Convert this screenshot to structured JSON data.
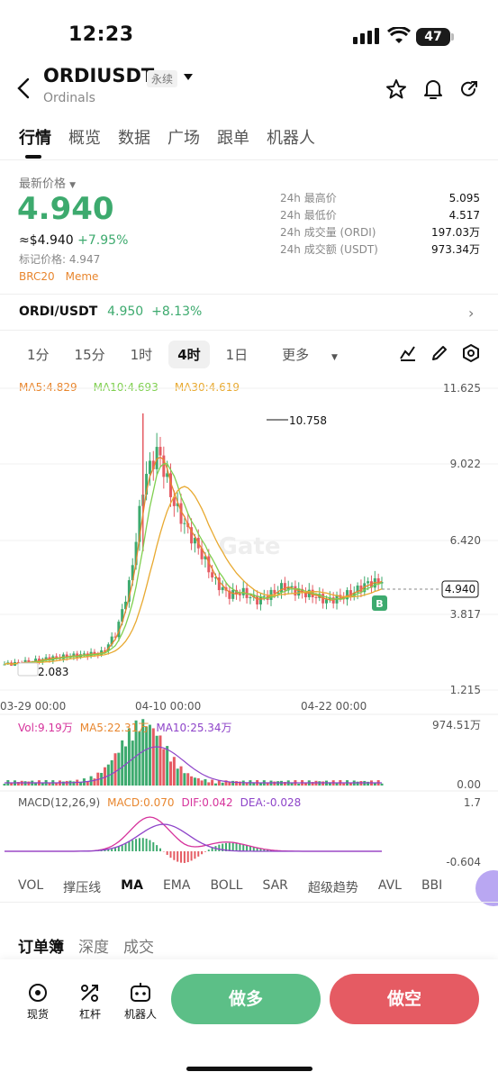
{
  "status": {
    "time": "12:23",
    "battery": "47"
  },
  "header": {
    "symbol": "ORDIUSDT",
    "type_tag": "永续",
    "subtitle": "Ordinals"
  },
  "tabs": [
    "行情",
    "概览",
    "数据",
    "广场",
    "跟单",
    "机器人"
  ],
  "ticker": {
    "price_label": "最新价格",
    "last_price": "4.940",
    "usd_price": "≈$4.940",
    "change_pct": "+7.95%",
    "mark_price": "标记价格: 4.947",
    "tags": [
      "BRC20",
      "Meme"
    ]
  },
  "stats": [
    {
      "label": "24h 最高价",
      "value": "5.095"
    },
    {
      "label": "24h 最低价",
      "value": "4.517"
    },
    {
      "label": "24h 成交量 (ORDI)",
      "value": "197.03万"
    },
    {
      "label": "24h 成交额 (USDT)",
      "value": "973.34万"
    }
  ],
  "spot_pair": {
    "pair": "ORDI/USDT",
    "price": "4.950",
    "change": "+8.13%"
  },
  "periods": {
    "items": [
      "1分",
      "15分",
      "1时",
      "4时",
      "1日",
      "更多"
    ],
    "active": "4时"
  },
  "ma_legend": {
    "ma5": "MA5:4.829",
    "ma10": "MA10:4.693",
    "ma30": "MA30:4.619"
  },
  "price_axis": [
    "11.625",
    "9.022",
    "6.420",
    "3.817",
    "1.215"
  ],
  "date_axis": [
    "03-29 00:00",
    "04-10 00:00",
    "04-22 00:00"
  ],
  "annotations": {
    "high": "10.758",
    "low": "2.083",
    "current": "4.940",
    "buy_marker": "B"
  },
  "watermark": "Gate",
  "volume": {
    "legend": {
      "vol": "Vol:9.19万",
      "ma5": "MA5:22.31万",
      "ma10": "MA10:25.34万"
    },
    "axis": [
      "974.51万",
      "0.00"
    ]
  },
  "macd": {
    "legend": {
      "name": "MACD(12,26,9)",
      "macd": "MACD:0.070",
      "dif": "DIF:0.042",
      "dea": "DEA:-0.028"
    },
    "axis": [
      "1.7",
      "-0.604"
    ]
  },
  "indicator_tabs": {
    "items": [
      "VOL",
      "撑压线",
      "MA",
      "EMA",
      "BOLL",
      "SAR",
      "超级趋势",
      "AVL",
      "BBI"
    ],
    "active": "MA"
  },
  "book_tabs": {
    "items": [
      "订单簿",
      "深度",
      "成交"
    ],
    "active": "订单簿"
  },
  "bottom_nav": [
    {
      "label": "现货",
      "icon": "spot-icon"
    },
    {
      "label": "杠杆",
      "icon": "leverage-icon"
    },
    {
      "label": "机器人",
      "icon": "robot-icon"
    }
  ],
  "actions": {
    "long": "做多",
    "short": "做空"
  },
  "colors": {
    "up": "#3daa6e",
    "down": "#e55b63",
    "ma5": "#e8862e",
    "ma10": "#7fcf4f",
    "ma30": "#e8a930",
    "macd_dif": "#d6339c",
    "macd_dea": "#8e44c9"
  },
  "chart_data": {
    "type": "candlestick",
    "interval": "4时",
    "ylim": [
      1.215,
      11.625
    ],
    "close_series": [
      2.1,
      2.15,
      2.2,
      2.3,
      2.35,
      2.4,
      2.45,
      2.5,
      3.2,
      5.0,
      8.5,
      9.5,
      7.8,
      6.8,
      6.0,
      5.0,
      4.5,
      4.6,
      4.3,
      4.5,
      4.8,
      4.6,
      4.5,
      4.3,
      4.4,
      4.6,
      4.9,
      4.94
    ],
    "high": 10.758,
    "low": 2.083,
    "last": 4.94
  }
}
